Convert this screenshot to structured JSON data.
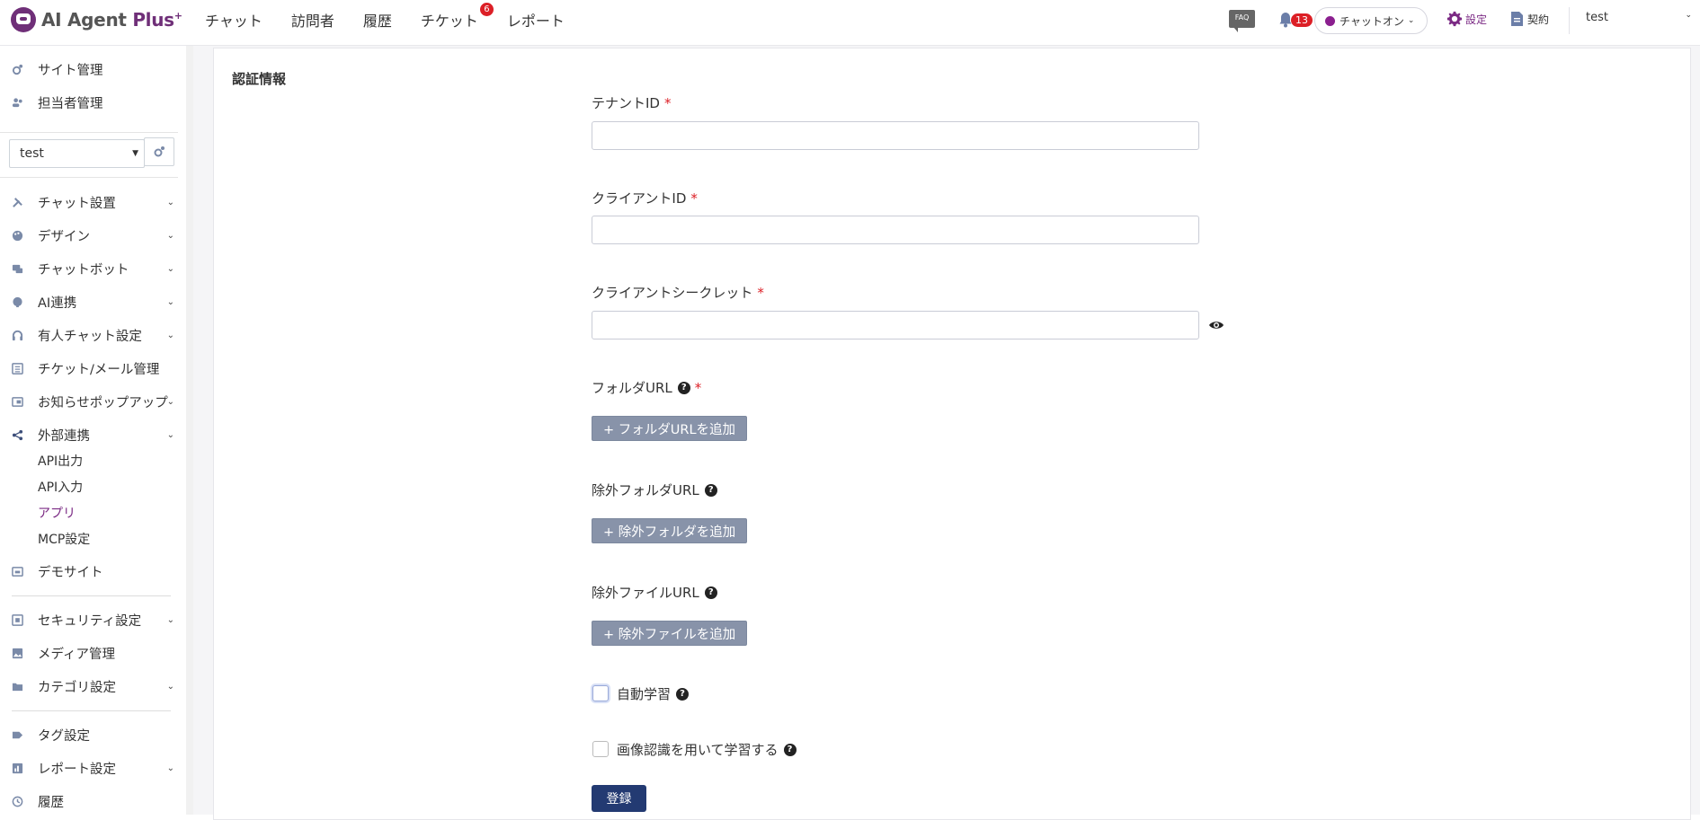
{
  "brand": {
    "name_ai": "AI Agent ",
    "name_plus": "Plus",
    "mark": "+"
  },
  "nav": {
    "items": [
      {
        "label": "チャット"
      },
      {
        "label": "訪問者"
      },
      {
        "label": "履歴"
      },
      {
        "label": "チケット",
        "badge": "6"
      },
      {
        "label": "レポート"
      }
    ]
  },
  "header": {
    "faq_label": "FAQ",
    "notification_count": "13",
    "chat_status": "チャットオン",
    "settings_label": "設定",
    "contract_label": "契約",
    "user_name": "test",
    "status_color": "#8b1f8f",
    "accent_color": "#7b2a84"
  },
  "sidebar": {
    "top_items": [
      {
        "label": "サイト管理",
        "icon": "gear-icon"
      },
      {
        "label": "担当者管理",
        "icon": "users-icon"
      }
    ],
    "site_select_value": "test",
    "items": [
      {
        "label": "チャット設置",
        "icon": "tools-icon",
        "chevron": true
      },
      {
        "label": "デザイン",
        "icon": "palette-icon",
        "chevron": true
      },
      {
        "label": "チャットボット",
        "icon": "chat-icon",
        "chevron": true
      },
      {
        "label": "AI連携",
        "icon": "brain-icon",
        "chevron": true
      },
      {
        "label": "有人チャット設定",
        "icon": "headset-icon",
        "chevron": true
      },
      {
        "label": "チケット/メール管理",
        "icon": "list-icon",
        "chevron": false
      },
      {
        "label": "お知らせポップアップ",
        "icon": "popup-icon",
        "chevron": true
      },
      {
        "label": "外部連携",
        "icon": "share-icon",
        "chevron": true
      }
    ],
    "sub_items": [
      {
        "label": "API出力"
      },
      {
        "label": "API入力"
      },
      {
        "label": "アプリ",
        "active": true
      },
      {
        "label": "MCP設定"
      }
    ],
    "items2": [
      {
        "label": "デモサイト",
        "icon": "window-icon",
        "chevron": false
      },
      {
        "label": "セキュリティ設定",
        "icon": "shield-icon",
        "chevron": true
      },
      {
        "label": "メディア管理",
        "icon": "image-icon",
        "chevron": false
      },
      {
        "label": "カテゴリ設定",
        "icon": "folder-icon",
        "chevron": true
      },
      {
        "label": "タグ設定",
        "icon": "tag-icon",
        "chevron": false
      },
      {
        "label": "レポート設定",
        "icon": "report-icon",
        "chevron": true
      },
      {
        "label": "履歴",
        "icon": "history-icon",
        "chevron": false
      }
    ]
  },
  "form": {
    "section_title": "認証情報",
    "tenant_label": "テナントID",
    "tenant_value": "",
    "client_id_label": "クライアントID",
    "client_id_value": "",
    "client_secret_label": "クライアントシークレット",
    "client_secret_value": "",
    "folder_url_label": "フォルダURL",
    "add_folder_button": "+ フォルダURLを追加",
    "exclude_folder_label": "除外フォルダURL",
    "add_exclude_folder_button": "+ 除外フォルダを追加",
    "exclude_file_label": "除外ファイルURL",
    "add_exclude_file_button": "+ 除外ファイルを追加",
    "auto_learn_label": "自動学習",
    "auto_learn_checked": false,
    "image_learn_label": "画像認識を用いて学習する",
    "image_learn_checked": false,
    "submit_label": "登録",
    "required_mark": "*",
    "help_mark": "?"
  }
}
